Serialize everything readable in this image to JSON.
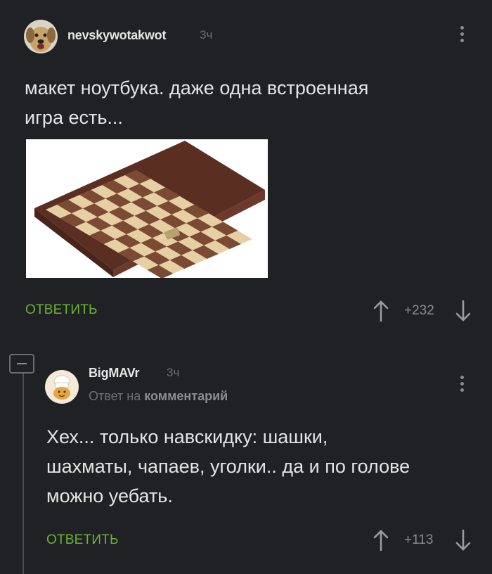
{
  "comments": [
    {
      "username": "nevskywotakwot",
      "time": "3ч",
      "text_lines": [
        "макет ноутбука. даже одна встроенная",
        "игра есть..."
      ],
      "reply_label": "ОТВЕТИТЬ",
      "rating": "+232",
      "avatar_icon": "dog-avatar-icon",
      "image_icon": "chessboard-image"
    },
    {
      "username": "BigMAVr",
      "time": "3ч",
      "reply_to_prefix": "Ответ на",
      "reply_to_link": "комментарий",
      "text_lines": [
        "Хех... только навскидку: шашки,",
        "шахматы, чапаев, уголки.. да и по голове",
        "можно уебать."
      ],
      "reply_label": "ОТВЕТИТЬ",
      "rating": "+113",
      "avatar_icon": "chef-avatar-icon"
    }
  ],
  "colors": {
    "background": "#202124",
    "reply_green": "#6bb336",
    "muted": "#8a8b8e"
  }
}
